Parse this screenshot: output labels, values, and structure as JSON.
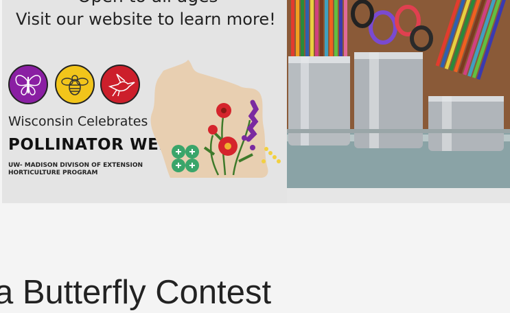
{
  "banner": {
    "line_top": "Open to all ages",
    "line_visit": "Visit our website to learn more!",
    "badges": [
      {
        "icon": "butterfly-icon",
        "color": "#8a1fa3"
      },
      {
        "icon": "bee-icon",
        "color": "#f2c51b"
      },
      {
        "icon": "hummingbird-icon",
        "color": "#cc1f2b"
      }
    ],
    "celebrates": "Wisconsin Celebrates",
    "pollinator_week": "POLLINATOR WEEK",
    "extension_line1": "UW- MADISON DIVISON OF EXTENSION",
    "extension_line2": "HORTICULTURE PROGRAM",
    "logo_icon": "four-h-clover-icon",
    "map_icon": "wisconsin-map-icon",
    "photo_icon": "art-supplies-photo"
  },
  "article": {
    "title": "a Butterfly Contest"
  }
}
